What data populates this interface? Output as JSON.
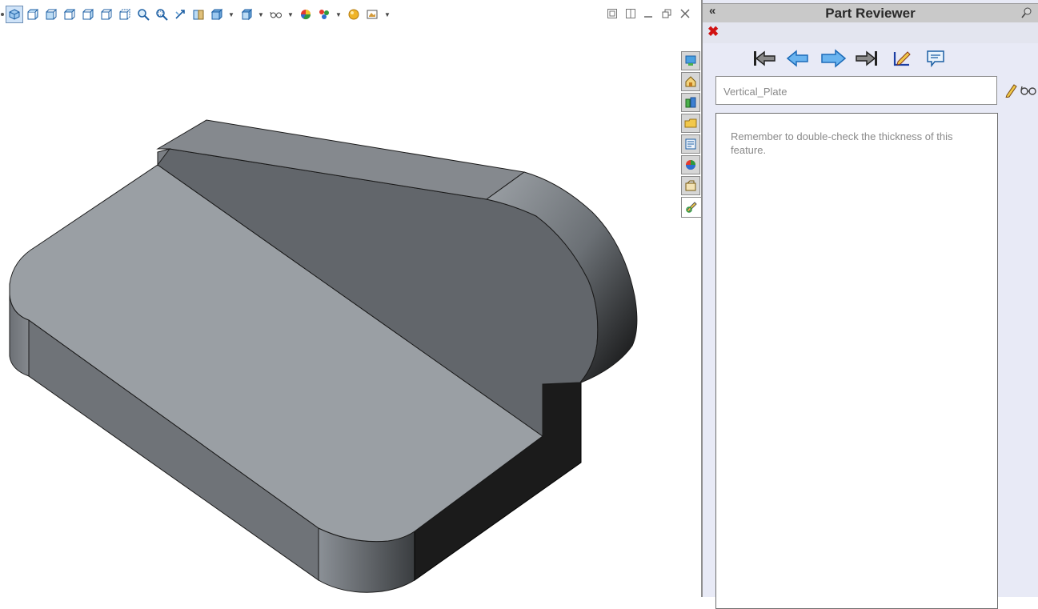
{
  "view_toolbar": {
    "icons": [
      "view-orientation-icon",
      "isometric-view-icon",
      "front-view-icon",
      "top-view-icon",
      "right-view-icon",
      "dimetric-view-icon",
      "zoom-to-fit-icon",
      "zoom-to-area-icon",
      "rotate-view-icon",
      "section-view-icon",
      "display-style-icon",
      "hide-show-items-icon",
      "appearance-icon",
      "scene-icon",
      "view-settings-icon"
    ]
  },
  "task_tabs": [
    "solidworks-resources-icon",
    "design-library-icon",
    "file-explorer-icon",
    "view-palette-icon",
    "appearances-icon",
    "custom-properties-icon",
    "part-reviewer-icon"
  ],
  "pane": {
    "title": "Part Reviewer",
    "collapse_symbol": "«",
    "close_symbol": "✖",
    "nav_buttons": [
      "first-step-icon",
      "previous-step-icon",
      "next-step-icon",
      "last-step-icon",
      "edit-comment-icon",
      "comment-bubble-icon"
    ],
    "feature_name": "Vertical_Plate",
    "comment_text": "Remember to double-check the thickness of this feature."
  },
  "colors": {
    "pane_background": "#e8eaf6",
    "header_background": "#c9c9c9",
    "close_red": "#d11212",
    "nav_blue": "#2f8fe0"
  }
}
